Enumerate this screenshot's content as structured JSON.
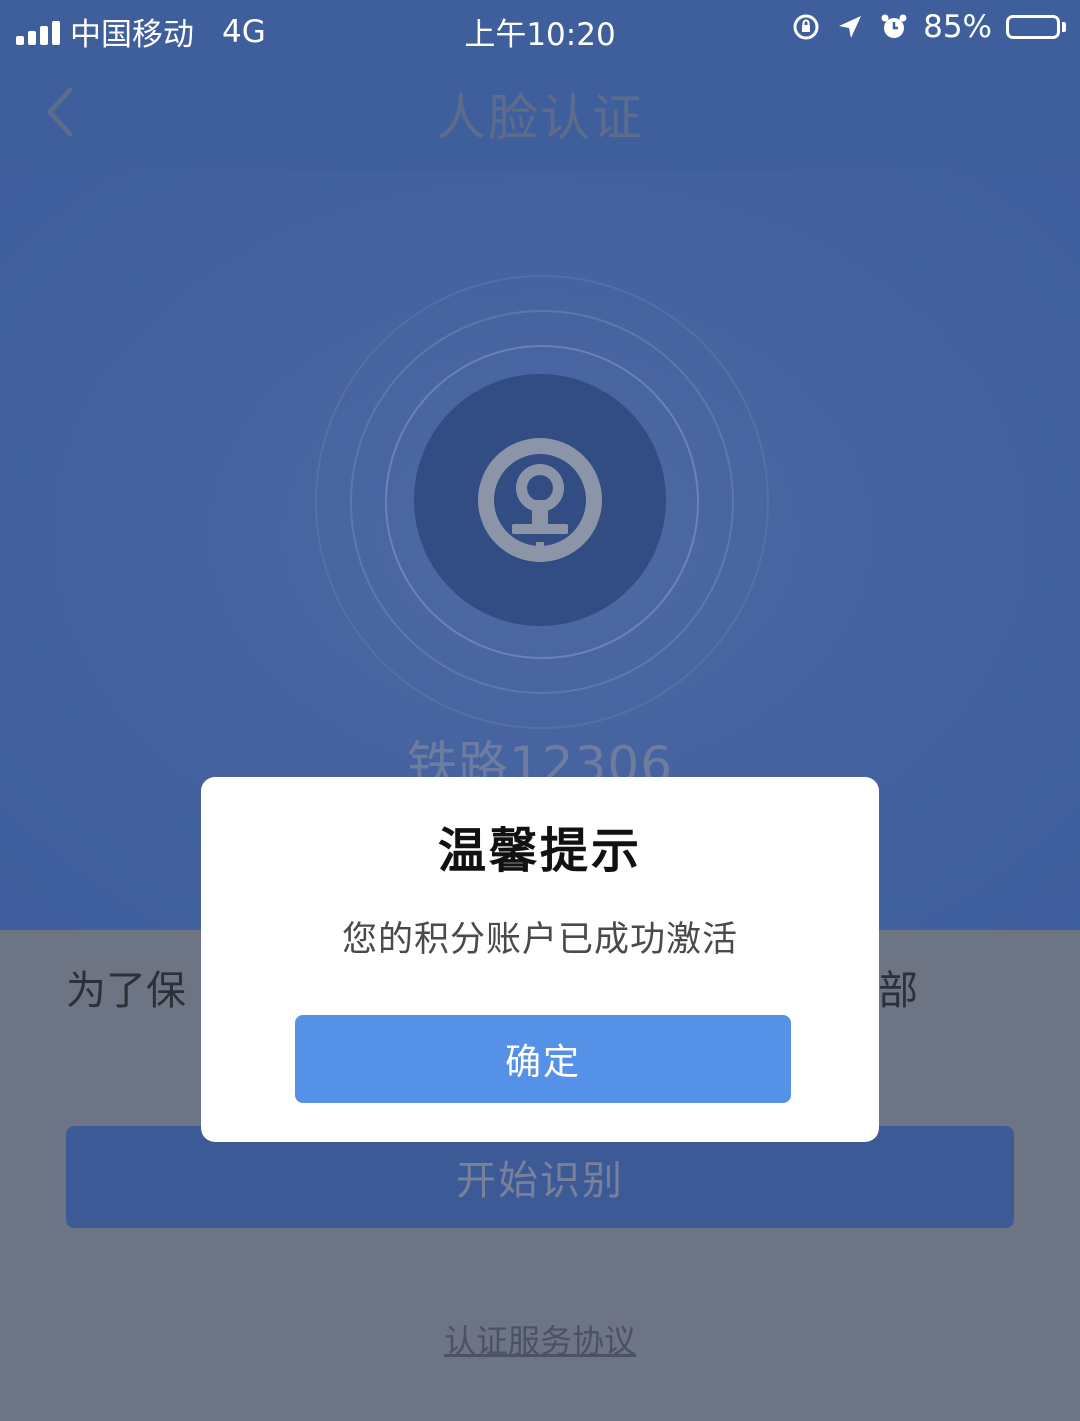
{
  "status_bar": {
    "carrier": "中国移动",
    "network": "4G",
    "time": "上午10:20",
    "battery_percent": "85%",
    "battery_level": 0.85,
    "icons": [
      "rotation-lock-icon",
      "location-arrow-icon",
      "alarm-icon",
      "battery-icon"
    ]
  },
  "nav": {
    "title": "人脸认证",
    "back_icon": "chevron-left-icon"
  },
  "hero": {
    "logo_icon": "railway-logo-icon",
    "brand_name": "铁路12306"
  },
  "content": {
    "intro_visible_left": "为了保",
    "intro_visible_right": "部",
    "start_button_label": "开始识别",
    "agreement_link": "认证服务协议"
  },
  "dialog": {
    "title": "温馨提示",
    "message": "您的积分账户已成功激活",
    "confirm_label": "确定"
  },
  "colors": {
    "nav_blue": "#3e5f9c",
    "confirm_blue": "#5591e6",
    "overlay_gray": "#6d7484"
  }
}
